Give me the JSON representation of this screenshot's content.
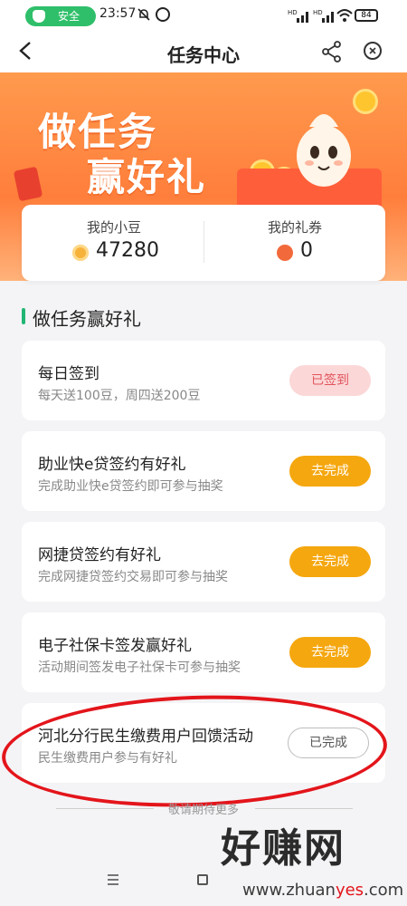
{
  "status_bar": {
    "safe_label": "安全",
    "time": "23:57",
    "battery": "84"
  },
  "nav": {
    "title": "任务中心"
  },
  "banner": {
    "slogan_line1": "做任务",
    "slogan_line2": "赢好礼"
  },
  "stats": {
    "beans_label": "我的小豆",
    "beans_value": "47280",
    "coupons_label": "我的礼券",
    "coupons_value": "0"
  },
  "section": {
    "title": "做任务赢好礼"
  },
  "tasks": [
    {
      "title": "每日签到",
      "subtitle": "每天送100豆，周四送200豆",
      "button": "已签到"
    },
    {
      "title": "助业快e贷签约有好礼",
      "subtitle": "完成助业快e贷签约即可参与抽奖",
      "button": "去完成"
    },
    {
      "title": "网捷贷签约有好礼",
      "subtitle": "完成网捷贷签约交易即可参与抽奖",
      "button": "去完成"
    },
    {
      "title": "电子社保卡签发赢好礼",
      "subtitle": "活动期间签发电子社保卡可参与抽奖",
      "button": "去完成"
    },
    {
      "title": "河北分行民生缴费用户回馈活动",
      "subtitle": "民生缴费用户参与有好礼",
      "button": "已完成"
    }
  ],
  "footer": {
    "more": "敬请期待更多"
  },
  "watermark": {
    "text": "好赚网",
    "url_prefix": "www.zhuan",
    "url_accent": "yes",
    "url_suffix": ".com"
  },
  "colors": {
    "accent_orange": "#ff7e3b",
    "button_yellow": "#f5a70f",
    "section_green": "#22b573",
    "annotation_red": "#e3151b"
  }
}
